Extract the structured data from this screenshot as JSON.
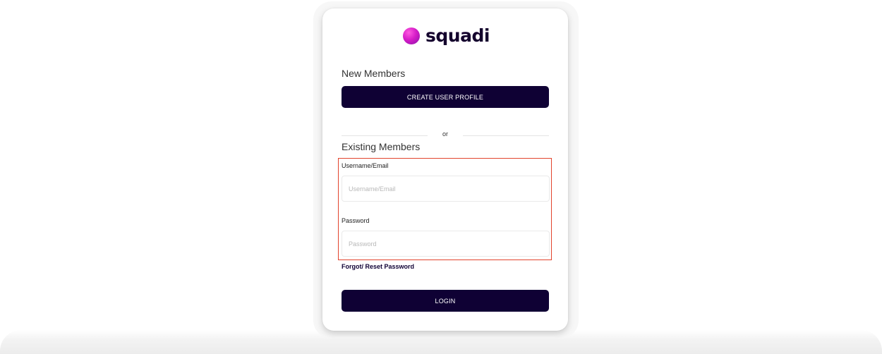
{
  "brand": {
    "name": "squadi",
    "logo_icon": "squadi-logo-icon",
    "accent_color": "#d61dc8",
    "primary_color": "#0f0134"
  },
  "new_members": {
    "heading": "New Members",
    "create_button_label": "CREATE USER PROFILE"
  },
  "divider": {
    "text": "or"
  },
  "existing_members": {
    "heading": "Existing Members",
    "username": {
      "label": "Username/Email",
      "placeholder": "Username/Email",
      "value": ""
    },
    "password": {
      "label": "Password",
      "placeholder": "Password",
      "value": ""
    },
    "forgot_link": "Forgot/ Reset Password",
    "login_button_label": "LOGIN"
  },
  "annotation": {
    "highlight_color": "#e2432c"
  }
}
